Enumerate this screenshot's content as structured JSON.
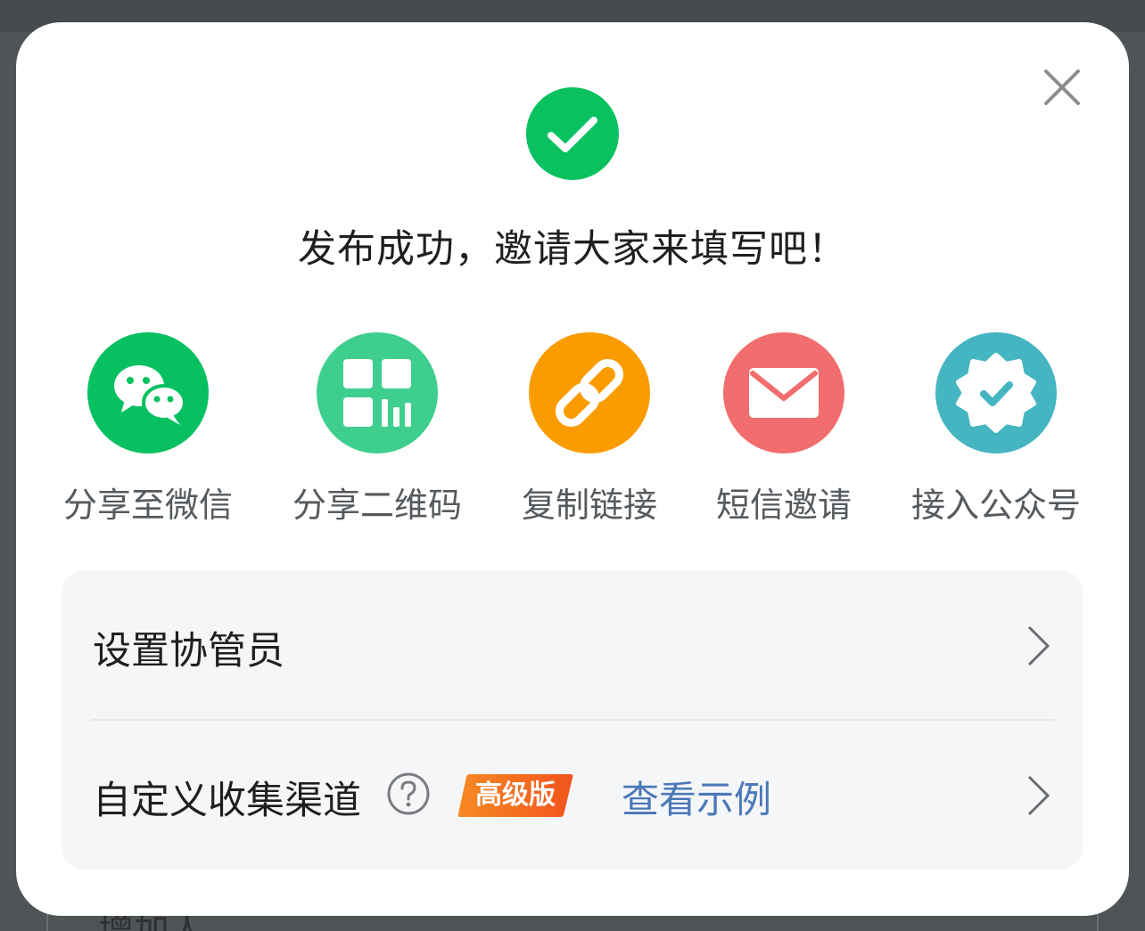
{
  "background": {
    "field_text": "增加人"
  },
  "modal": {
    "title": "发布成功，邀请大家来填写吧！",
    "close_icon": "close-icon",
    "success_icon": "check-circle-icon",
    "share_options": [
      {
        "label": "分享至微信",
        "icon": "wechat-icon",
        "color": "#07c160"
      },
      {
        "label": "分享二维码",
        "icon": "qrcode-icon",
        "color": "#3ecf8e"
      },
      {
        "label": "复制链接",
        "icon": "link-icon",
        "color": "#fa9b00"
      },
      {
        "label": "短信邀请",
        "icon": "mail-icon",
        "color": "#f26d6d"
      },
      {
        "label": "接入公众号",
        "icon": "verified-badge-icon",
        "color": "#45b5c1"
      }
    ],
    "settings": {
      "collaborators_label": "设置协管员",
      "channel_label": "自定义收集渠道",
      "premium_badge": "高级版",
      "example_link": "查看示例"
    }
  },
  "colors": {
    "overlay": "#474b4d",
    "success": "#0ac160",
    "link": "#4a78b8",
    "badge_start": "#f57b20",
    "badge_end": "#f25a1e"
  }
}
